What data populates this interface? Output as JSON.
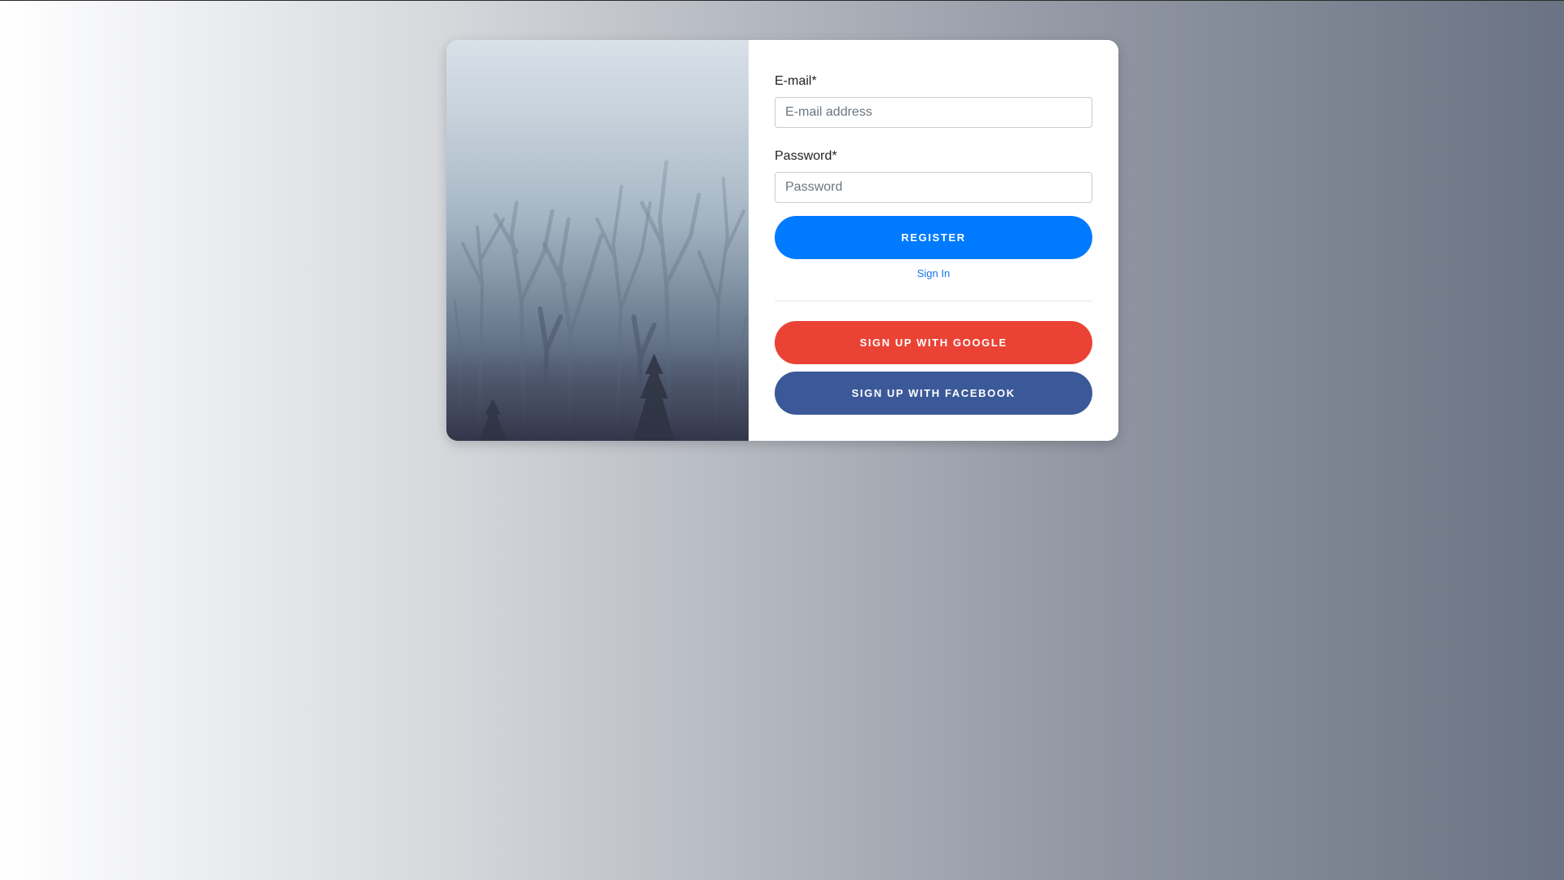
{
  "form": {
    "email_label": "E-mail*",
    "email_placeholder": "E-mail address",
    "password_label": "Password*",
    "password_placeholder": "Password",
    "register_label": "REGISTER",
    "signin_label": "Sign In",
    "google_label": "SIGN UP WITH GOOGLE",
    "facebook_label": "SIGN UP WITH FACEBOOK"
  },
  "colors": {
    "primary": "#007bff",
    "google": "#ea4335",
    "facebook": "#3b5998",
    "link": "#1a73e8"
  },
  "image": {
    "icon": "foggy-forest-photo"
  }
}
